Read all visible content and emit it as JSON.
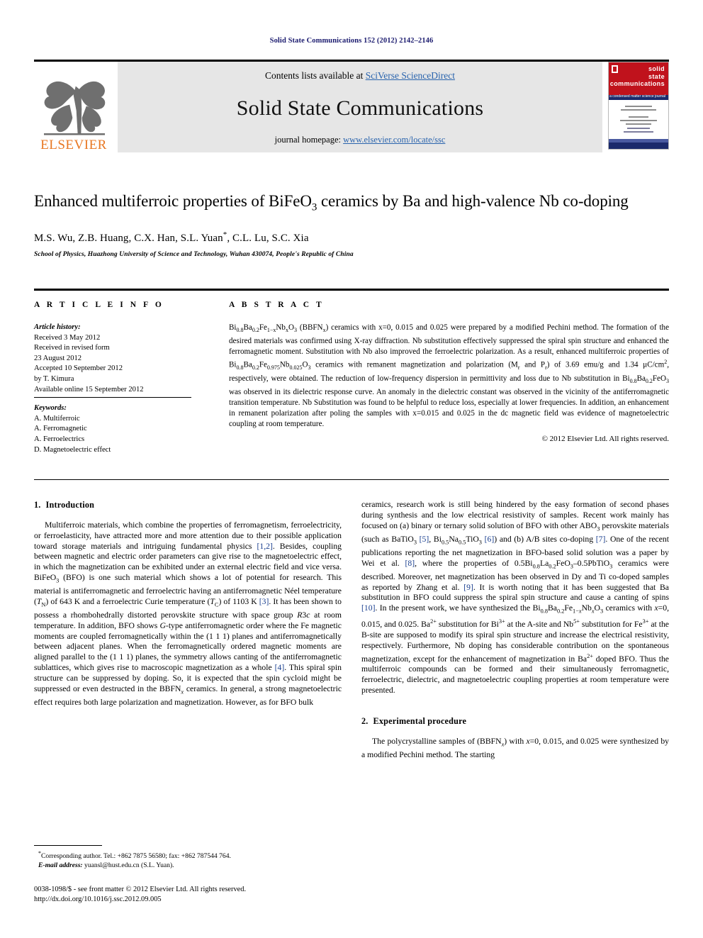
{
  "running_head": "Solid State Communications 152 (2012) 2142–2146",
  "masthead": {
    "contents_prefix": "Contents lists available at ",
    "sciencedirect_link": "SciVerse ScienceDirect",
    "journal_title": "Solid State Communications",
    "homepage_prefix": "journal homepage: ",
    "homepage_url": "www.elsevier.com/locate/ssc",
    "publisher_wordmark": "ELSEVIER",
    "cover_title_lines": [
      "solid",
      "state",
      "communications"
    ],
    "cover_subtitle": "a condensed matter science journal",
    "accent_color": "#c0121c",
    "link_color": "#2a64ad",
    "elsevier_orange": "#E87722"
  },
  "article": {
    "title_line1": "Enhanced multiferroic properties of BiFeO",
    "title_sub1": "3",
    "title_line1b": " ceramics by Ba and high-valence",
    "title_line2": "Nb co-doping",
    "authors": "M.S. Wu, Z.B. Huang, C.X. Han, S.L. Yuan",
    "corresponding_mark": "*",
    "authors_tail": ", C.L. Lu, S.C. Xia",
    "affiliation": "School of Physics, Huazhong University of Science and Technology, Wuhan 430074, People's Republic of China"
  },
  "info": {
    "heading": "A R T I C L E   I N F O",
    "history_label": "Article history:",
    "history_lines": [
      "Received 3 May 2012",
      "Received in revised form",
      "23 August 2012",
      "Accepted 10 September 2012",
      "by T. Kimura",
      "Available online 15 September 2012"
    ],
    "keywords_label": "Keywords:",
    "keywords": [
      "A. Multiferroic",
      "A. Ferromagnetic",
      "A. Ferroelectrics",
      "D. Magnetoelectric effect"
    ]
  },
  "abstract": {
    "heading": "A B S T R A C T",
    "text_parts": {
      "p1a": "Bi",
      "s08": "0.8",
      "p1b": "Ba",
      "s02": "0.2",
      "p1c": "Fe",
      "s1x": "1−x",
      "p1d": "Nb",
      "sx": "x",
      "p1e": "O",
      "s3": "3",
      "p1f": " (BBFN",
      "sxx": "x",
      "p1g": ") ceramics with x=0, 0.015 and 0.025 were prepared by a modified Pechini method. The formation of the desired materials was confirmed using X-ray diffraction. Nb substitution effectively suppressed the spiral spin structure and enhanced the ferromagnetic moment. Substitution with Nb also improved the ferroelectric polarization. As a result, enhanced multiferroic properties of ",
      "p2a": "Bi",
      "p2b": "Ba",
      "p2c": "Fe",
      "s0975": "0.975",
      "p2d": "Nb",
      "s0025": "0.025",
      "p2e": "O",
      "p2f": " ceramics with remanent magnetization and polarization (M",
      "sr1": "r",
      "p2g": " and P",
      "sr2": "r",
      "p2h": ") of 3.69 emu/g and 1.34 μC/cm",
      "sup2": "2",
      "p2i": ", respectively, were obtained. The reduction of low-frequency dispersion in permittivity and loss due to Nb substitution in ",
      "p3a": "Bi",
      "p3b": "Ba",
      "p3c": "FeO",
      "p3d": " was observed in its dielectric response curve. An anomaly in the dielectric constant was observed in the vicinity of the antiferromagnetic transition temperature. Nb Substitution was found to be helpful to reduce loss, especially at lower frequencies. In addition, an enhancement in remanent polarization after poling the samples with x=0.015 and 0.025 in the dc magnetic field was evidence of magnetoelectric coupling at room temperature."
    },
    "copyright": "© 2012 Elsevier Ltd. All rights reserved."
  },
  "body": {
    "section1": {
      "number": "1.",
      "title": "Introduction",
      "para_left_1": "Multiferroic materials, which combine the properties of ferromagnetism, ferroelectricity, or ferroelasticity, have attracted more and more attention due to their possible application toward storage materials and intriguing fundamental physics [1,2]. Besides, coupling between magnetic and electric order parameters can give rise to the magnetoelectric effect, in which the magnetization can be exhibited under an external electric field and vice versa. BiFeO3 (BFO) is one such material which shows a lot of potential for research. This material is antiferromagnetic and ferroelectric having an antiferromagnetic Néel temperature (TN) of 643 K and a ferroelectric Curie temperature (TC) of 1103 K [3]. It has been shown to possess a rhombohedrally distorted perovskite structure with space group R3c at room temperature. In addition, BFO shows G-type antiferromagnetic order where the Fe magnetic moments are coupled ferromagnetically within the (1 1 1) planes and antiferromagnetically between adjacent planes. When the ferromagnetically ordered magnetic moments are aligned parallel to the (1 1 1) planes, the symmetry allows canting of the antiferromagnetic sublattices, which gives rise to macroscopic magnetization as a whole [4]. This spiral spin structure can be suppressed by doping. So, it is expected that the spin cycloid might be suppressed or even destructed in the BBFNx ceramics. In general, a strong magnetoelectric effect requires both large polarization and magnetization. However, as for BFO bulk",
      "para_right_1": "ceramics, research work is still being hindered by the easy formation of second phases during synthesis and the low electrical resistivity of samples. Recent work mainly has focused on (a) binary or ternary solid solution of BFO with other ABO3 perovskite materials (such as BaTiO3 [5], Bi0.5Na0.5TiO3 [6]) and (b) A/B sites co-doping [7]. One of the recent publications reporting the net magnetization in BFO-based solid solution was a paper by Wei et al. [8], where the properties of 0.5Bi0.8La0.2FeO3–0.5PbTiO3 ceramics were described. Moreover, net magnetization has been observed in Dy and Ti co-doped samples as reported by Zhang et al. [9]. It is worth noting that it has been suggested that Ba substitution in BFO could suppress the spiral spin structure and cause a canting of spins [10]. In the present work, we have synthesized the Bi0.8Ba0.2Fe1−xNbxO3 ceramics with x=0, 0.015, and 0.025. Ba2+ substitution for Bi3+ at the A-site and Nb5+ substitution for Fe3+ at the B-site are supposed to modify its spiral spin structure and increase the electrical resistivity, respectively. Furthermore, Nb doping has considerable contribution on the spontaneous magnetization, except for the enhancement of magnetization in Ba2+ doped BFO. Thus the multiferroic compounds can be formed and their simultaneously ferromagnetic, ferroelectric, dielectric, and magnetoelectric coupling properties at room temperature were presented."
    },
    "section2": {
      "number": "2.",
      "title": "Experimental procedure",
      "para_1": "The polycrystalline samples of (BBFNx) with x=0, 0.015, and 0.025 were synthesized by a modified Pechini method. The starting"
    }
  },
  "footnote": {
    "marker": "*",
    "line1": "Corresponding author. Tel.: +862 7875 56580; fax: +862 787544 764.",
    "email_label": "E-mail address:",
    "email": "yuansl@hust.edu.cn (S.L. Yuan)."
  },
  "footer": {
    "issn_line": "0038-1098/$ - see front matter © 2012 Elsevier Ltd. All rights reserved.",
    "doi_line": "http://dx.doi.org/10.1016/j.ssc.2012.09.005"
  }
}
